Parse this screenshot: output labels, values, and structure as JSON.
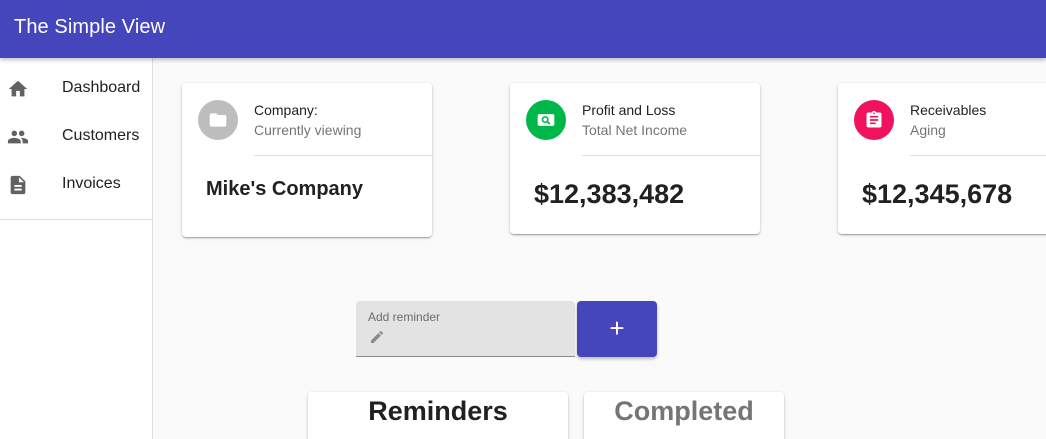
{
  "app": {
    "title": "The Simple View"
  },
  "sidebar": {
    "items": [
      {
        "label": "Dashboard",
        "icon": "home-icon"
      },
      {
        "label": "Customers",
        "icon": "people-icon"
      },
      {
        "label": "Invoices",
        "icon": "document-icon"
      }
    ]
  },
  "cards": {
    "company": {
      "title": "Company:",
      "subtitle": "Currently viewing",
      "value": "Mike's Company",
      "avatar_color": "#bdbdbd",
      "icon": "folder-icon"
    },
    "profit": {
      "title": "Profit and Loss",
      "subtitle": "Total Net Income",
      "value": "$12,383,482",
      "avatar_color": "#00b84a",
      "icon": "money-search-icon"
    },
    "receivables": {
      "title": "Receivables",
      "subtitle": "Aging",
      "value": "$12,345,678",
      "avatar_color": "#f0115f",
      "icon": "clipboard-icon"
    }
  },
  "reminder": {
    "label": "Add reminder",
    "value": "",
    "add_label": "+"
  },
  "tabs": [
    {
      "label": "Reminders",
      "active": true
    },
    {
      "label": "Completed",
      "active": false
    }
  ],
  "colors": {
    "primary": "#4545bc",
    "text": "#212121",
    "muted": "#757575",
    "inactive_tab": "#757575"
  }
}
